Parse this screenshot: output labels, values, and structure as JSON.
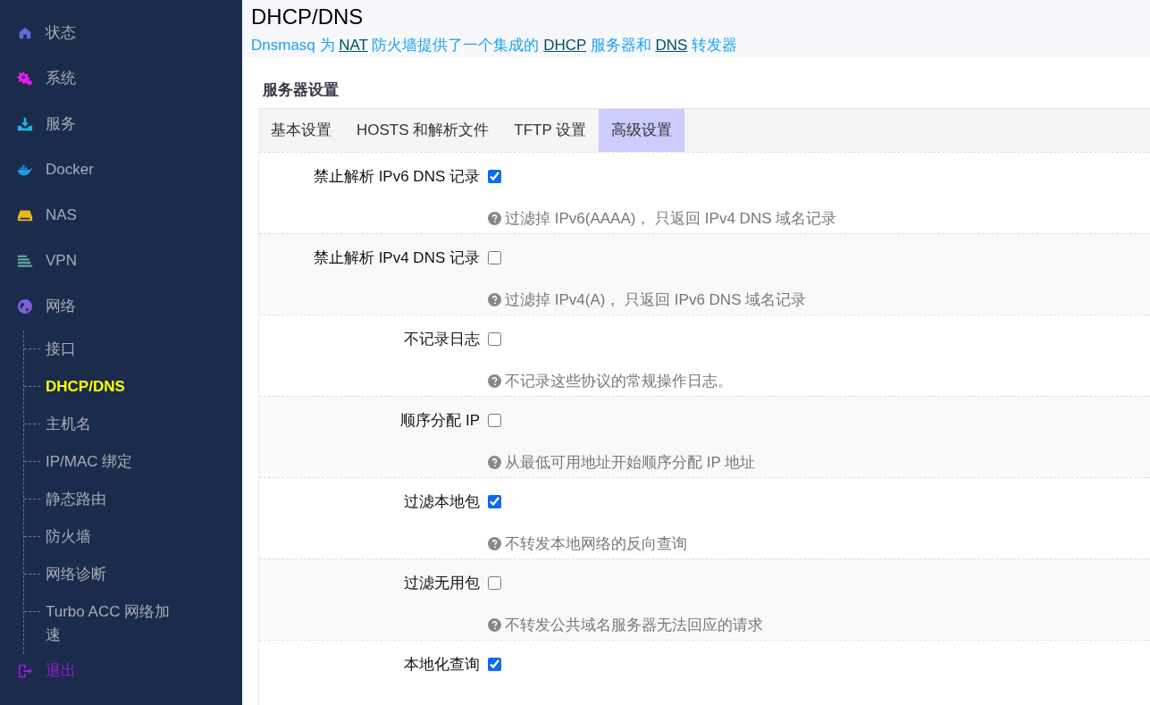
{
  "sidebar": {
    "items": [
      {
        "label": "状态",
        "color": "#5b6ee1",
        "selected": false
      },
      {
        "label": "系统",
        "color": "#e81ce8",
        "selected": false
      },
      {
        "label": "服务",
        "color": "#1fb5e0",
        "selected": false
      },
      {
        "label": "Docker",
        "color": "#1f9de0",
        "selected": false
      },
      {
        "label": "NAS",
        "color": "#e8b71a",
        "selected": false
      },
      {
        "label": "VPN",
        "color": "#5fa8a0",
        "selected": false
      },
      {
        "label": "网络",
        "color": "#8060d8",
        "selected": false,
        "children": [
          {
            "label": "接口",
            "selected": false
          },
          {
            "label": "DHCP/DNS",
            "selected": true
          },
          {
            "label": "主机名",
            "selected": false
          },
          {
            "label": "IP/MAC 绑定",
            "selected": false
          },
          {
            "label": "静态路由",
            "selected": false
          },
          {
            "label": "防火墙",
            "selected": false
          },
          {
            "label": "网络诊断",
            "selected": false
          },
          {
            "label": "Turbo ACC 网络加速",
            "selected": false
          }
        ]
      },
      {
        "label": "退出",
        "color": "#9a1ad8",
        "selected": false
      }
    ]
  },
  "page": {
    "title": "DHCP/DNS",
    "description": [
      {
        "text": "Dnsmasq 为 ",
        "link": false
      },
      {
        "text": "NAT",
        "link": true
      },
      {
        "text": " 防火墙提供了一个集成的 ",
        "link": false
      },
      {
        "text": "DHCP",
        "link": true
      },
      {
        "text": " 服务器和 ",
        "link": false
      },
      {
        "text": "DNS",
        "link": true
      },
      {
        "text": " 转发器",
        "link": false
      }
    ]
  },
  "section": {
    "title": "服务器设置",
    "tabs": [
      {
        "label": "基本设置",
        "selected": false
      },
      {
        "label": "HOSTS 和解析文件",
        "selected": false
      },
      {
        "label": "TFTP 设置",
        "selected": false
      },
      {
        "label": "高级设置",
        "selected": true
      }
    ],
    "options": [
      {
        "label": "禁止解析 IPv6 DNS 记录",
        "checked": true,
        "help": "过滤掉 IPv6(AAAA)， 只返回 IPv4 DNS 域名记录"
      },
      {
        "label": "禁止解析 IPv4 DNS 记录",
        "checked": false,
        "help": "过滤掉 IPv4(A)， 只返回 IPv6 DNS 域名记录"
      },
      {
        "label": "不记录日志",
        "checked": false,
        "help": "不记录这些协议的常规操作日志。"
      },
      {
        "label": "顺序分配 IP",
        "checked": false,
        "help": "从最低可用地址开始顺序分配 IP 地址"
      },
      {
        "label": "过滤本地包",
        "checked": true,
        "help": "不转发本地网络的反向查询"
      },
      {
        "label": "过滤无用包",
        "checked": false,
        "help": "不转发公共域名服务器无法回应的请求"
      },
      {
        "label": "本地化查询",
        "checked": true
      }
    ]
  }
}
